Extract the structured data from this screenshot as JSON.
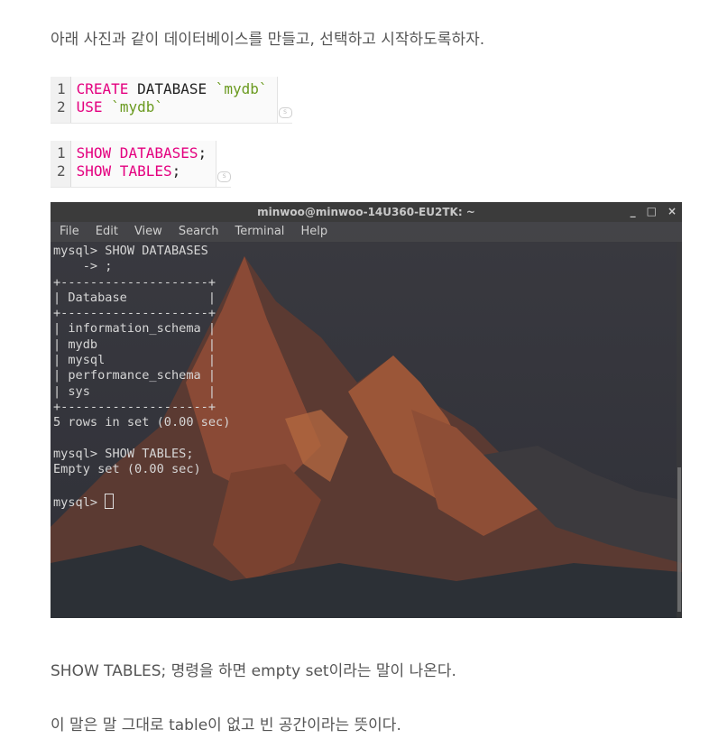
{
  "intro": "아래 사진과 같이 데이터베이스를 만들고, 선택하고 시작하도록하자.",
  "code_block_1": {
    "line_numbers": [
      "1",
      "2"
    ],
    "line1_kw": "CREATE",
    "line1_mid": " DATABASE ",
    "line1_str": "`mydb`",
    "line2_kw": "USE",
    "line2_sp": " ",
    "line2_str": "`mydb`"
  },
  "code_block_2": {
    "line_numbers": [
      "1",
      "2"
    ],
    "line1_kw": "SHOW DATABASES",
    "line1_end": ";",
    "line2_kw": "SHOW TABLES",
    "line2_end": ";"
  },
  "copy_icon_label": "S",
  "terminal": {
    "title": "minwoo@minwoo-14U360-EU2TK: ~",
    "controls": [
      "_",
      "□",
      "×"
    ],
    "menu": [
      "File",
      "Edit",
      "View",
      "Search",
      "Terminal",
      "Help"
    ],
    "lines": [
      "mysql> SHOW DATABASES",
      "    -> ;",
      "+--------------------+",
      "| Database           |",
      "+--------------------+",
      "| information_schema |",
      "| mydb               |",
      "| mysql              |",
      "| performance_schema |",
      "| sys                |",
      "+--------------------+",
      "5 rows in set (0.00 sec)",
      "",
      "mysql> SHOW TABLES;",
      "Empty set (0.00 sec)",
      ""
    ],
    "prompt": "mysql> "
  },
  "para_2": "SHOW TABLES; 명령을 하면 empty set이라는 말이 나온다.",
  "para_3": "이 말은 말 그대로 table이 없고 빈 공간이라는 뜻이다."
}
